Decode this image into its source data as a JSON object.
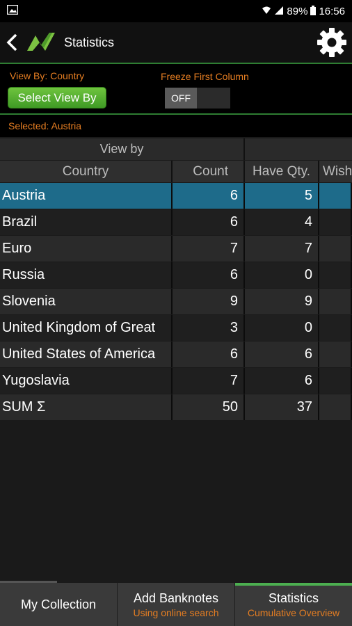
{
  "status_bar": {
    "battery": "89%",
    "time": "16:56"
  },
  "app_bar": {
    "title": "Statistics"
  },
  "controls": {
    "view_by_label": "View By: Country",
    "select_button": "Select View By",
    "freeze_label": "Freeze First Column",
    "freeze_state": "OFF",
    "selected_label": "Selected: Austria"
  },
  "table": {
    "group_header": "View by",
    "columns": [
      "Country",
      "Count",
      "Have Qty.",
      "Wish"
    ],
    "rows": [
      {
        "country": "Austria",
        "count": "6",
        "have": "5"
      },
      {
        "country": "Brazil",
        "count": "6",
        "have": "4"
      },
      {
        "country": "Euro",
        "count": "7",
        "have": "7"
      },
      {
        "country": "Russia",
        "count": "6",
        "have": "0"
      },
      {
        "country": "Slovenia",
        "count": "9",
        "have": "9"
      },
      {
        "country": "United Kingdom of Great",
        "count": "3",
        "have": "0"
      },
      {
        "country": "United States of America",
        "count": "6",
        "have": "6"
      },
      {
        "country": "Yugoslavia",
        "count": "7",
        "have": "6"
      },
      {
        "country": "SUM Σ",
        "count": "50",
        "have": "37"
      }
    ],
    "selected_row": "Austria"
  },
  "bottom_nav": [
    {
      "label": "My Collection",
      "sub": ""
    },
    {
      "label": "Add Banknotes",
      "sub": "Using online search"
    },
    {
      "label": "Statistics",
      "sub": "Cumulative Overview"
    }
  ],
  "colors": {
    "accent_orange": "#e67e22",
    "green": "#4caf50",
    "selected_row": "#1e6b8a"
  }
}
